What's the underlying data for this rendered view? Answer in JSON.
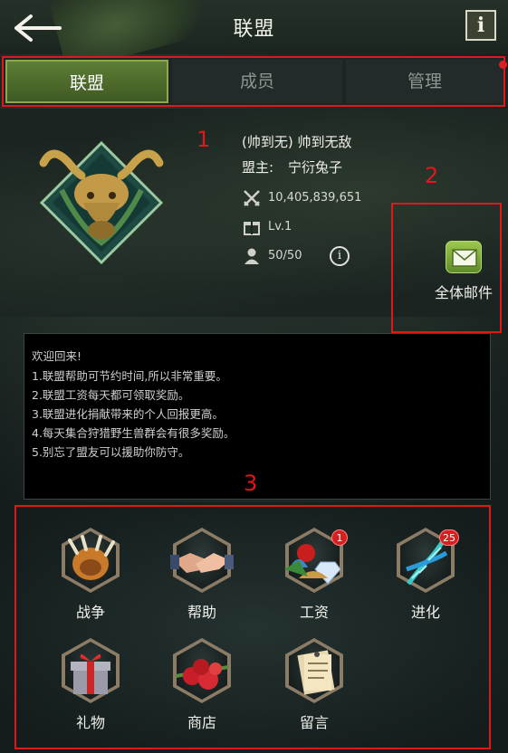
{
  "header": {
    "title": "联盟",
    "back_icon": "arrow-left-icon",
    "info_label": "i"
  },
  "tabs": [
    {
      "label": "联盟",
      "active": true
    },
    {
      "label": "成员",
      "active": false
    },
    {
      "label": "管理",
      "active": false,
      "has_notification": true
    }
  ],
  "alliance": {
    "name": "(帅到无) 帅到无敌",
    "leader_label": "盟主:",
    "leader_name": "宁衍兔子",
    "power": "10,405,839,651",
    "level": "Lv.1",
    "members": "50/50",
    "member_info_label": "i"
  },
  "mail": {
    "label": "全体邮件",
    "icon": "envelope-icon"
  },
  "welcome": {
    "lines": [
      "欢迎回来!",
      "1.联盟帮助可节约时间,所以非常重要。",
      "2.联盟工资每天都可领取奖励。",
      "3.联盟进化捐献带来的个人回报更高。",
      "4.每天集合狩猎野生兽群会有很多奖励。",
      "5.别忘了盟友可以援助你防守。"
    ]
  },
  "functions": [
    {
      "label": "战争",
      "icon": "claw-icon"
    },
    {
      "label": "帮助",
      "icon": "handshake-icon"
    },
    {
      "label": "工资",
      "icon": "resources-icon",
      "badge": "1"
    },
    {
      "label": "进化",
      "icon": "dna-icon",
      "badge": "25"
    },
    {
      "label": "礼物",
      "icon": "gift-box-icon"
    },
    {
      "label": "商店",
      "icon": "fruit-basket-icon"
    },
    {
      "label": "留言",
      "icon": "notes-icon"
    }
  ],
  "annotations": [
    "1",
    "2",
    "3"
  ],
  "colors": {
    "accent_green": "#5e7d35",
    "annotation_red": "#e01818",
    "badge_red": "#d42020"
  }
}
